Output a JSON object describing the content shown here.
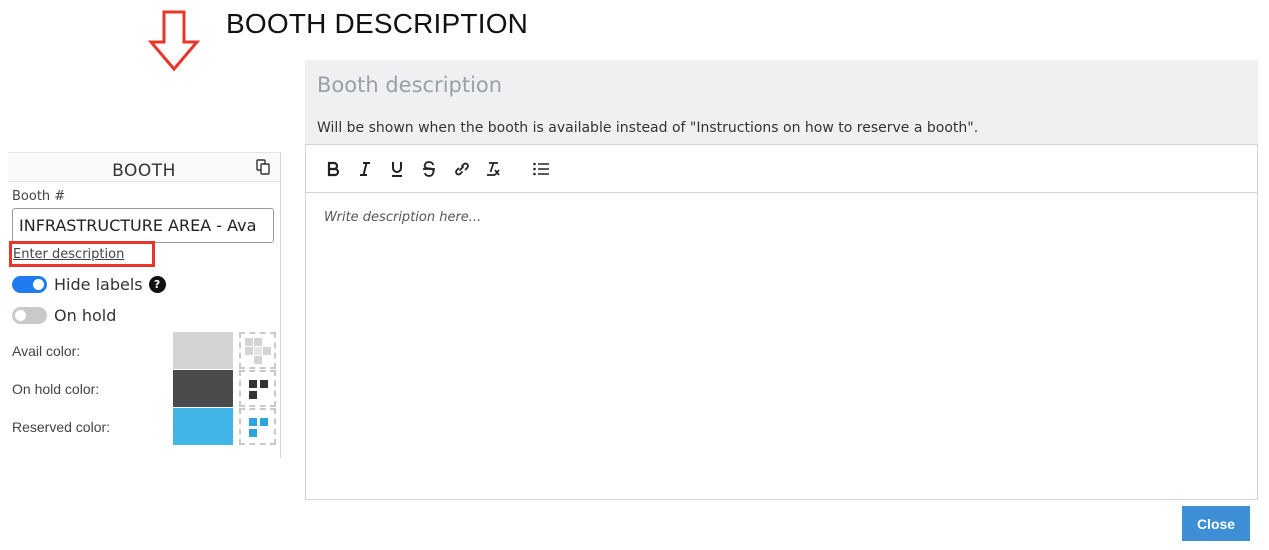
{
  "annotation": {
    "title": "BOOTH DESCRIPTION",
    "arrow_icon": "down-arrow-outline-icon",
    "arrow_color": "#e8352a"
  },
  "booth_panel": {
    "title": "BOOTH",
    "copy_icon": "copy-icon",
    "booth_number_label": "Booth #",
    "booth_number_value": "INFRASTRUCTURE AREA - Ava",
    "enter_description_link": "Enter description",
    "hide_labels": {
      "label": "Hide labels",
      "on": true,
      "help_icon": "question-icon",
      "help_text": "?"
    },
    "on_hold": {
      "label": "On hold",
      "on": false
    },
    "colors": [
      {
        "label": "Avail color:",
        "swatch": "#d3d4d5",
        "pattern_color": "#d3d4d5"
      },
      {
        "label": "On hold color:",
        "swatch": "#4a4b4d",
        "pattern_color": "#333333"
      },
      {
        "label": "Reserved color:",
        "swatch": "#41b6e6",
        "pattern_color": "#2aa5dd"
      }
    ]
  },
  "modal": {
    "title": "Booth description",
    "subtitle": "Will be shown when the booth is available instead of \"Instructions on how to reserve a booth\".",
    "toolbar": [
      "bold-icon",
      "italic-icon",
      "underline-icon",
      "strikethrough-icon",
      "link-icon",
      "clear-format-icon",
      "bullet-list-icon"
    ],
    "editor_placeholder": "Write description here...",
    "close_button": "Close",
    "accent_color": "#3e8fd6"
  }
}
